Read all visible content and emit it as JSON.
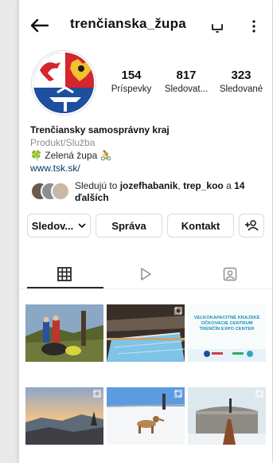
{
  "header": {
    "username": "trenčianska_župa"
  },
  "profile": {
    "stats": [
      {
        "value": "154",
        "label": "Príspevky"
      },
      {
        "value": "817",
        "label": "Sledovat..."
      },
      {
        "value": "323",
        "label": "Sledované"
      }
    ],
    "name": "Trenčiansky samosprávny kraj",
    "category": "Produkt/Služba",
    "bio_line": "🍀 Zelená župa 🚴",
    "website": "www.tsk.sk/"
  },
  "followed_by": {
    "prefix": "Sledujú to ",
    "names": "jozefhabanik",
    "sep": ", ",
    "name2": "trep_koo",
    "mid": " a ",
    "others": "14 ďalších"
  },
  "buttons": {
    "following": "Sledov...",
    "message": "Správa",
    "contact": "Kontakt"
  },
  "tabs": [
    "grid",
    "reels",
    "tagged"
  ],
  "posts": [
    {
      "label": ""
    },
    {
      "label": ""
    },
    {
      "label": "VEĽKOKAPACITNÉ KRAJSKÉ OČKOVACIE CENTRUM TRENČÍN EXPO CENTER"
    },
    {
      "label": ""
    },
    {
      "label": ""
    },
    {
      "label": ""
    }
  ],
  "colors": {
    "link": "#00376b",
    "muted": "#8e8e8e",
    "border": "#dbdbdb",
    "coat_blue": "#1e4f9e",
    "coat_red": "#d6252b"
  }
}
